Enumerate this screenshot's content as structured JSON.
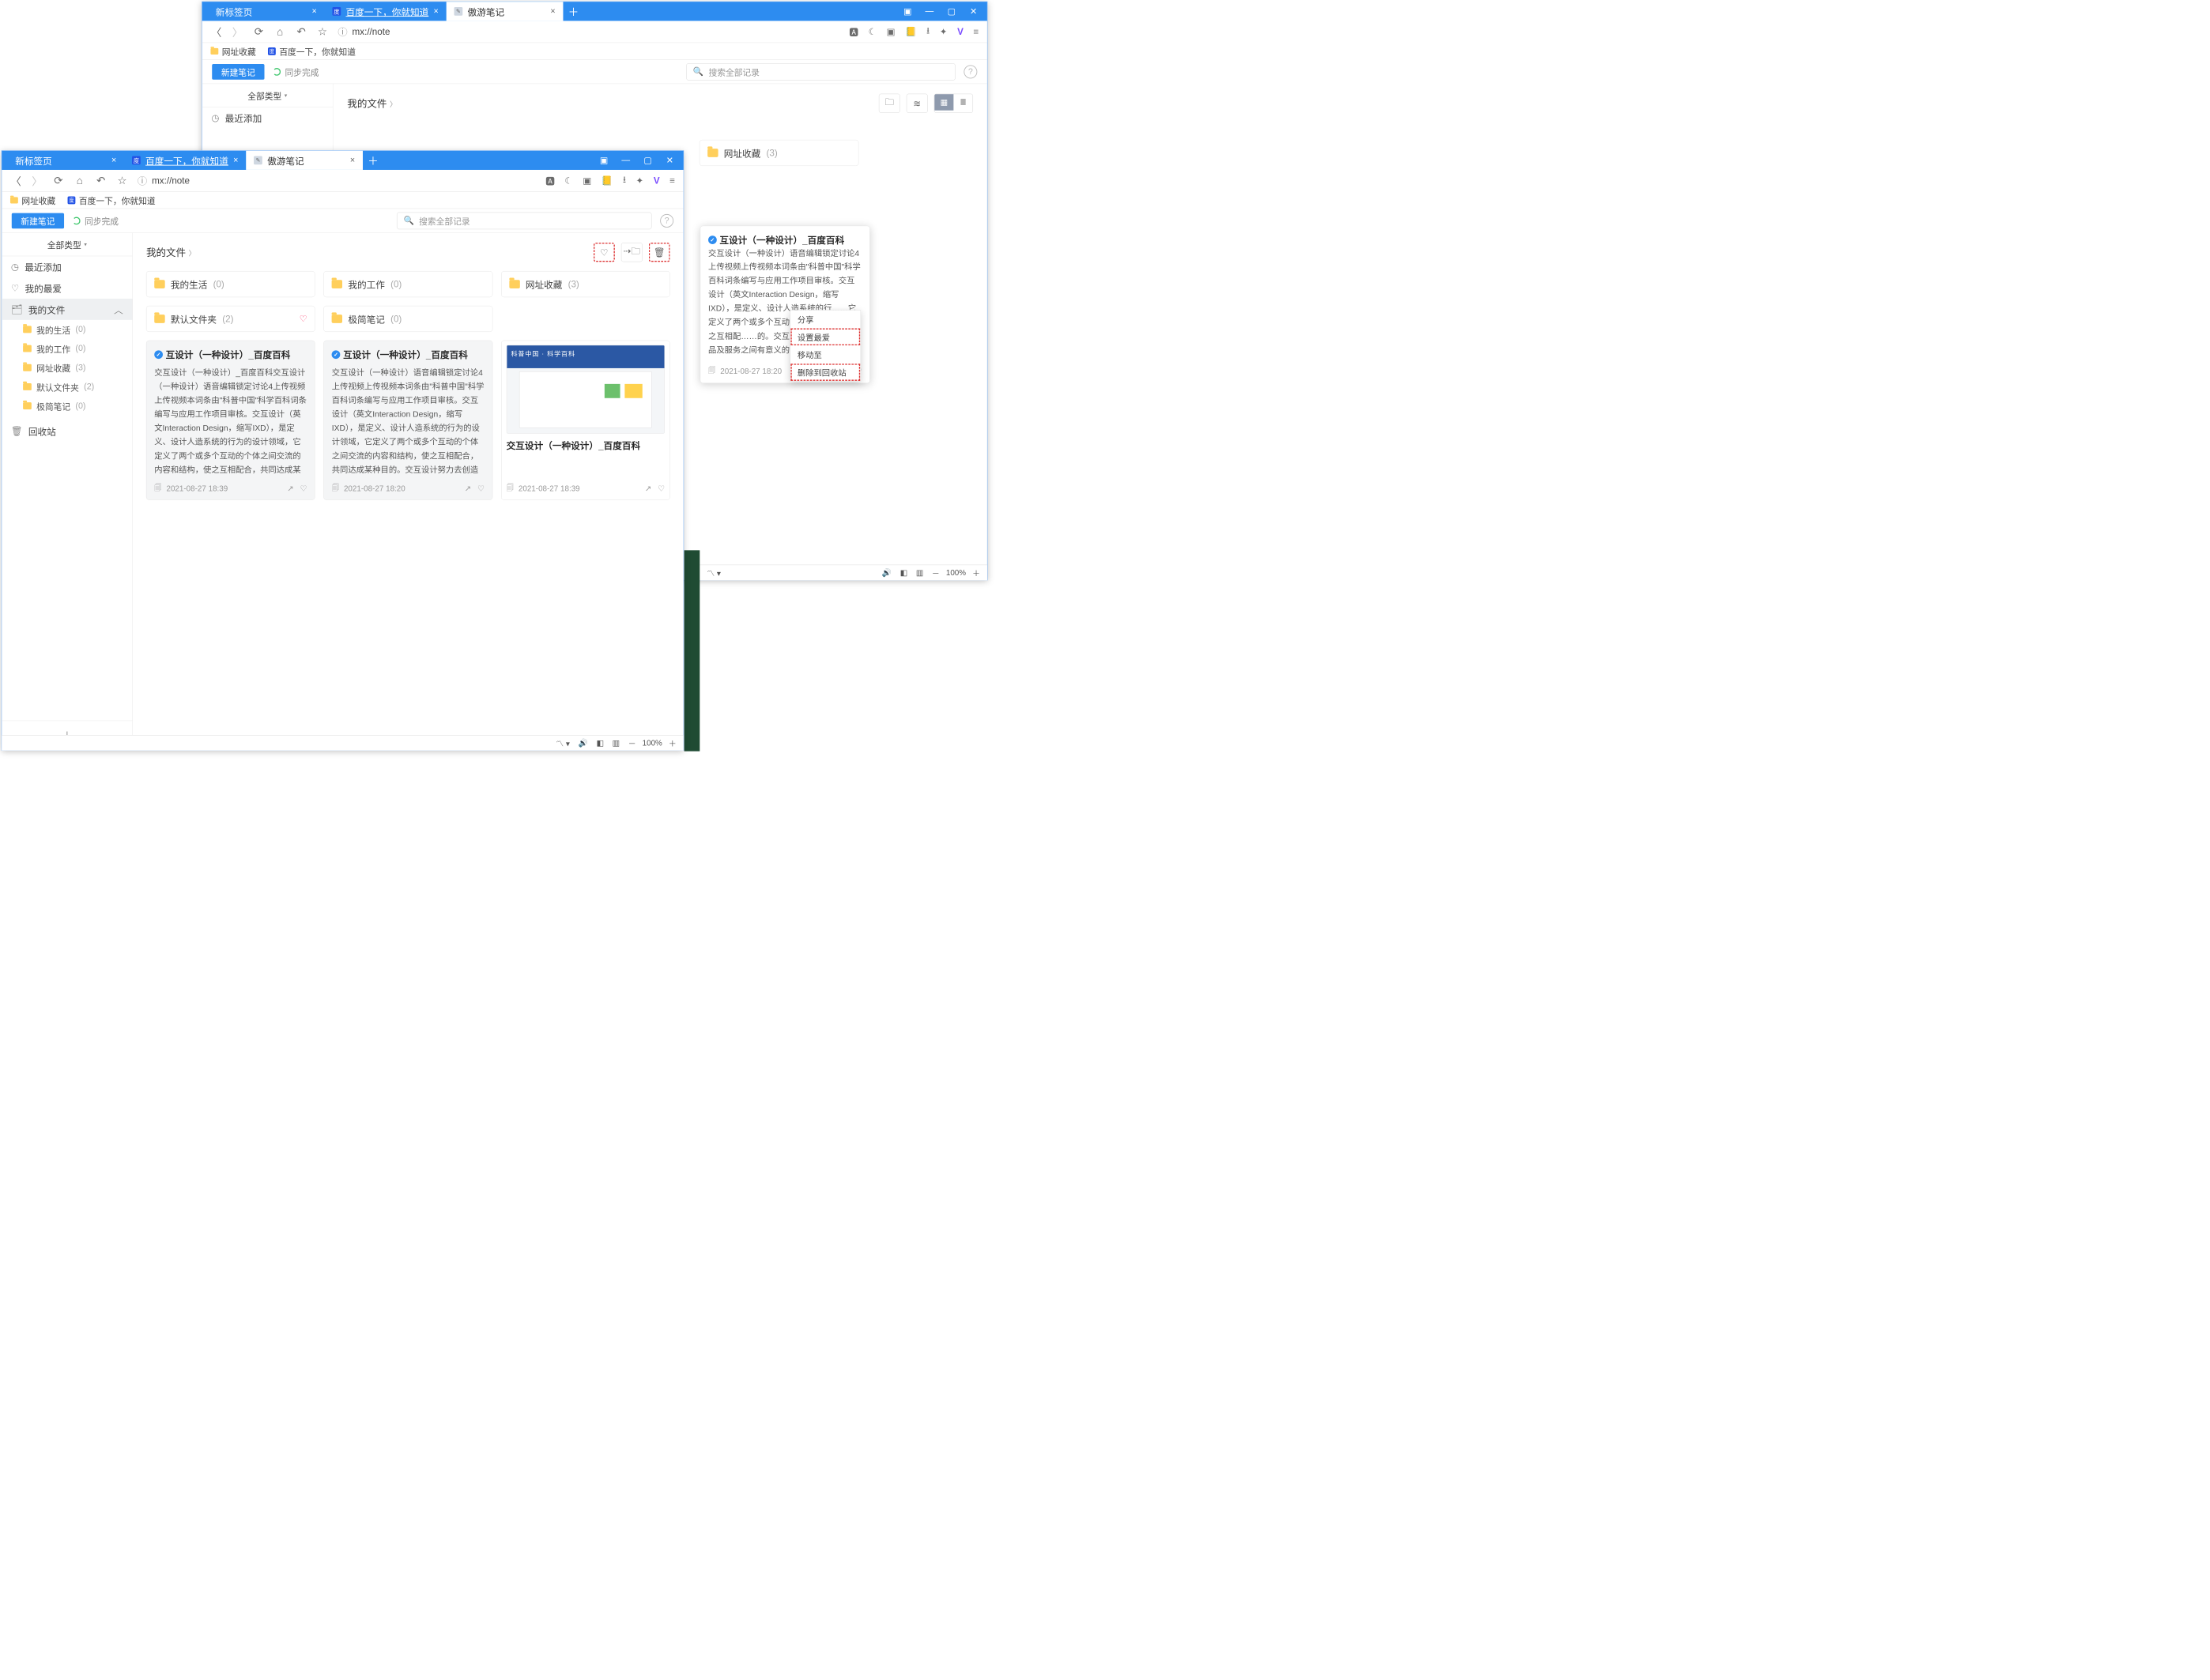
{
  "back": {
    "tabs": [
      {
        "label": "新标签页",
        "active": false
      },
      {
        "label": "百度一下，你就知道",
        "active": false,
        "icon": "baidu"
      },
      {
        "label": "傲游笔记",
        "active": true,
        "icon": "note"
      }
    ],
    "url": "mx://note",
    "bookmarks": {
      "favs": "网址收藏",
      "baidu": "百度一下，你就知道"
    },
    "toolbar": {
      "new_note": "新建笔记",
      "sync": "同步完成",
      "search_ph": "搜索全部记录"
    },
    "filter": "全部类型",
    "side": {
      "recent": "最近添加",
      "items_after": []
    },
    "crumb": "我的文件",
    "right_folder": {
      "name": "网址收藏",
      "count": "(3)"
    }
  },
  "front": {
    "tabs": [
      {
        "label": "新标签页",
        "active": false
      },
      {
        "label": "百度一下，你就知道",
        "active": false,
        "icon": "baidu"
      },
      {
        "label": "傲游笔记",
        "active": true,
        "icon": "note"
      }
    ],
    "url": "mx://note",
    "bookmarks": {
      "favs": "网址收藏",
      "baidu": "百度一下，你就知道"
    },
    "toolbar": {
      "new_note": "新建笔记",
      "sync": "同步完成",
      "search_ph": "搜索全部记录"
    },
    "filter": "全部类型",
    "side": {
      "recent": "最近添加",
      "fav": "我的最爱",
      "files": "我的文件",
      "sub": [
        {
          "name": "我的生活",
          "count": "(0)"
        },
        {
          "name": "我的工作",
          "count": "(0)"
        },
        {
          "name": "网址收藏",
          "count": "(3)"
        },
        {
          "name": "默认文件夹",
          "count": "(2)"
        },
        {
          "name": "极简笔记",
          "count": "(0)"
        }
      ],
      "trash": "回收站"
    },
    "crumb": "我的文件",
    "folders_row1": [
      {
        "name": "我的生活",
        "count": "(0)"
      },
      {
        "name": "我的工作",
        "count": "(0)"
      },
      {
        "name": "网址收藏",
        "count": "(3)"
      }
    ],
    "folders_row2": [
      {
        "name": "默认文件夹",
        "count": "(2)",
        "heart": true
      },
      {
        "name": "极简笔记",
        "count": "(0)"
      }
    ],
    "notes": [
      {
        "title": "互设计（一种设计）_百度百科",
        "body": "交互设计（一种设计）_百度百科交互设计（一种设计）语音编辑锁定讨论4上传视频上传视频本词条由\"科普中国\"科学百科词条编写与应用工作项目审核。交互设计（英文Interaction Design，缩写IXD），是定义、设计人造系统的行为的设计领域，它定义了两个或多个互动的个体之间交流的内容和结构，使之互相配合，共同达成某种目的。交互设计努力去创造和建立的是人与产品及……",
        "date": "2021-08-27  18:39"
      },
      {
        "title": "互设计（一种设计）_百度百科",
        "body": "交互设计（一种设计）语音编辑锁定讨论4上传视频上传视频本词条由\"科普中国\"科学百科词条编写与应用工作项目审核。交互设计（英文Interaction Design，缩写IXD），是定义、设计人造系统的行为的设计领域，它定义了两个或多个互动的个体之间交流的内容和结构，使之互相配合，共同达成某种目的。交互设计努力去创造和建立的是人与产品及服务之间有意义的关系，以\"在充满社……",
        "date": "2021-08-27  18:20"
      },
      {
        "title_below": "交互设计（一种设计）_百度百科",
        "date": "2021-08-27  18:39"
      }
    ]
  },
  "float_card": {
    "title": "互设计（一种设计）_百度百科",
    "body": "交互设计（一种设计）语音编辑锁定讨论4上传视频上传视频本词条由\"科普中国\"科学百科词条编写与应用工作项目审核。交互设计（英文Interaction Design，缩写IXD），是定义、设计人造系统的行……它定义了两个或多个互动……容和结构，使之互相配……的。交互设计努力去创……品及服务之间有意义的……",
    "date": "2021-08-27  18:20"
  },
  "ctx_menu": {
    "share": "分享",
    "set_fav": "设置最爱",
    "move_to": "移动至",
    "delete": "删除到回收站"
  },
  "status": {
    "zoom": "100%"
  }
}
